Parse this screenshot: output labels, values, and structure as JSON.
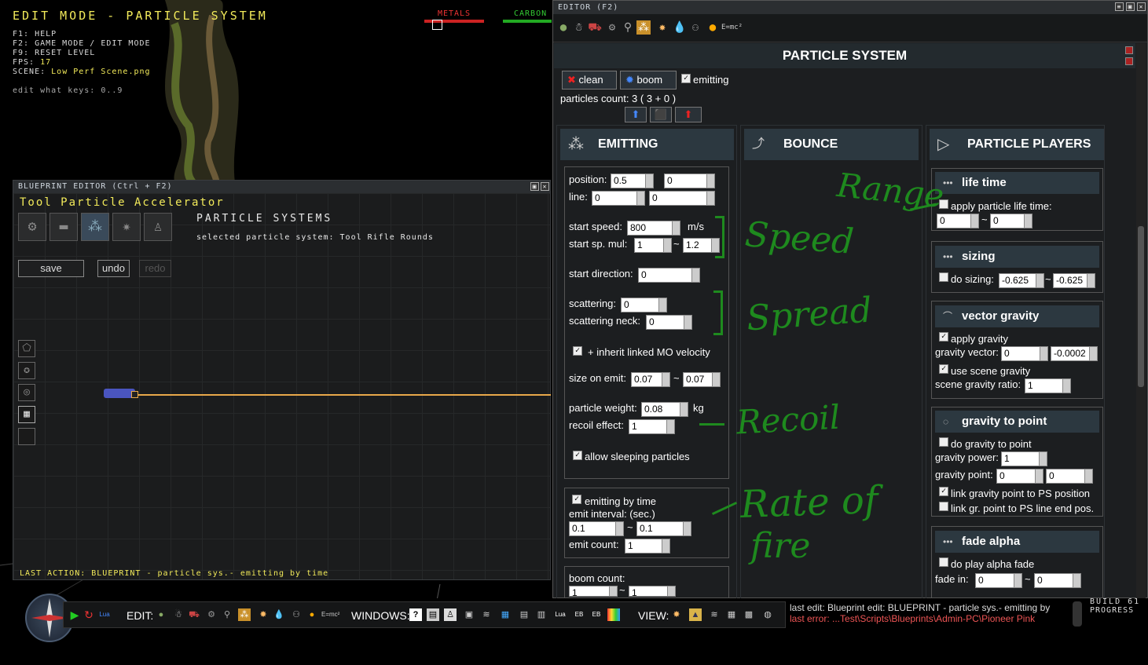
{
  "hud": {
    "title": "EDIT MODE - PARTICLE SYSTEM",
    "lines": [
      "F1: HELP",
      "F2: GAME MODE / EDIT MODE",
      "F9: RESET LEVEL"
    ],
    "fps_label": "FPS:",
    "fps_value": "17",
    "scene_label": "SCENE:",
    "scene_value": "Low Perf Scene.png",
    "edit_keys": "edit what keys: 0..9"
  },
  "resources": {
    "metals": "METALS",
    "carbon": "CARBON"
  },
  "blueprint": {
    "window_title": "BLUEPRINT EDITOR (Ctrl + F2)",
    "name": "Tool Particle Accelerator",
    "heading": "PARTICLE SYSTEMS",
    "selected": "selected particle system: Tool Rifle Rounds",
    "save": "save",
    "undo": "undo",
    "redo": "redo",
    "last_action": "LAST ACTION: BLUEPRINT - particle sys.- emitting by time"
  },
  "editor": {
    "window_title": "EDITOR (F2)",
    "header": "PARTICLE SYSTEM",
    "clean": "clean",
    "boom": "boom",
    "emitting": "emitting",
    "particles_count": "particles count: 3 ( 3 + 0 )",
    "sections": {
      "emitting": "EMITTING",
      "bounce": "BOUNCE",
      "players": "PARTICLE PLAYERS"
    },
    "emit": {
      "position_label": "position:",
      "position_x": "0.5",
      "position_y": "0",
      "line_label": "line:",
      "line_x": "0",
      "line_y": "0",
      "start_speed_label": "start speed:",
      "start_speed": "800",
      "speed_unit": "m/s",
      "start_sp_mul_label": "start sp. mul:",
      "start_sp_mul_min": "1",
      "start_sp_mul_max": "1.2",
      "start_direction_label": "start direction:",
      "start_direction": "0",
      "scattering_label": "scattering:",
      "scattering": "0",
      "scattering_neck_label": "scattering neck:",
      "scattering_neck": "0",
      "inherit_label": "+ inherit linked MO velocity",
      "size_label": "size on emit:",
      "size_min": "0.07",
      "size_max": "0.07",
      "weight_label": "particle weight:",
      "weight": "0.08",
      "weight_unit": "kg",
      "recoil_label": "recoil effect:",
      "recoil": "1",
      "sleeping_label": "allow sleeping particles",
      "by_time_label": "emitting by time",
      "interval_label": "emit interval: (sec.)",
      "interval_min": "0.1",
      "interval_max": "0.1",
      "count_label": "emit count:",
      "count": "1",
      "boom_count_label": "boom count:",
      "boom_min": "1",
      "boom_max": "1"
    },
    "players": {
      "life_time": "life time",
      "apply_life": "apply particle life time:",
      "life_min": "0",
      "life_max": "0",
      "sizing": "sizing",
      "do_sizing": "do sizing:",
      "sizing_min": "-0.625",
      "sizing_max": "-0.625",
      "vector_gravity": "vector gravity",
      "apply_gravity": "apply gravity",
      "gravity_vector_label": "gravity vector:",
      "gv_x": "0",
      "gv_y": "-0.0002",
      "use_scene_gravity": "use scene gravity",
      "scene_ratio_label": "scene gravity ratio:",
      "scene_ratio": "1",
      "gravity_to_point": "gravity to point",
      "do_gravity_point": "do gravity to point",
      "gravity_power_label": "gravity power:",
      "gravity_power": "1",
      "gravity_point_label": "gravity point:",
      "gp_x": "0",
      "gp_y": "0",
      "link_ps": "link gravity point to PS position",
      "link_line": "link gr. point to PS line end pos.",
      "fade_alpha": "fade alpha",
      "do_alpha": "do play alpha fade",
      "fade_in_label": "fade in:",
      "fade_in_min": "0",
      "fade_in_max": "0"
    }
  },
  "annotations": {
    "range": "Range",
    "speed": "Speed",
    "spread": "Spread",
    "recoil": "Recoil",
    "rate1": "Rate of",
    "rate2": "fire"
  },
  "toolbar": {
    "edit": "EDIT:",
    "windows": "WINDOWS:",
    "view": "VIEW:",
    "last_edit": "last edit: Blueprint edit: BLUEPRINT - particle sys.- emitting by",
    "last_error": "last error: ...Test\\Scripts\\Blueprints\\Admin-PC\\Pioneer Pink",
    "build": "BUILD 61",
    "progress": "PROGRESS"
  }
}
